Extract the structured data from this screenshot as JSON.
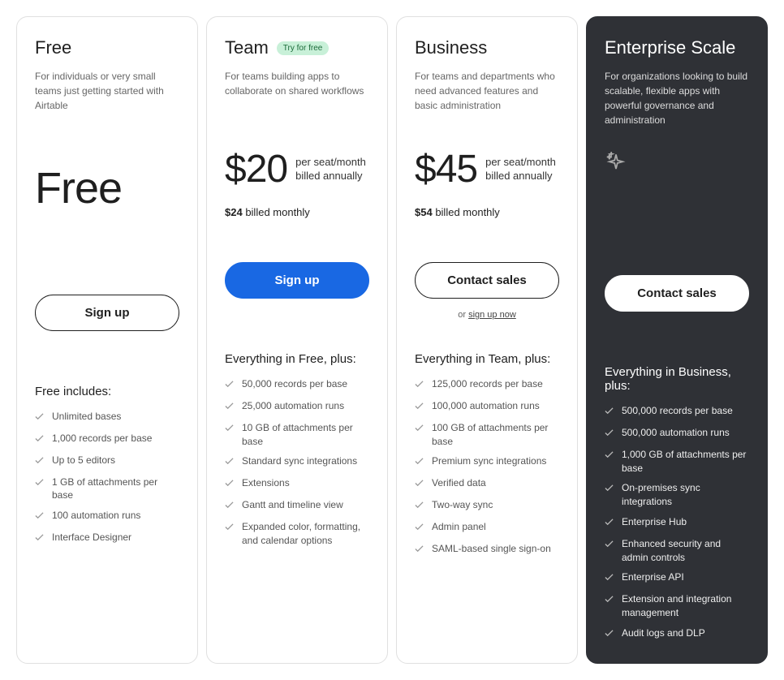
{
  "plans": [
    {
      "name": "Free",
      "badge": null,
      "desc": "For individuals or very small teams just getting started with Airtable",
      "price_big": "Free",
      "price_amount": null,
      "price_unit": null,
      "price_monthly_bold": null,
      "price_monthly_rest": null,
      "cta_label": "Sign up",
      "cta_style": "outline",
      "sub_cta_prefix": null,
      "sub_cta_link": null,
      "features_title": "Free includes:",
      "features": [
        "Unlimited bases",
        "1,000 records per base",
        "Up to 5 editors",
        "1 GB of attachments per base",
        "100 automation runs",
        "Interface Designer"
      ]
    },
    {
      "name": "Team",
      "badge": "Try for free",
      "desc": "For teams building apps to collaborate on shared workflows",
      "price_big": null,
      "price_amount": "$20",
      "price_unit": "per seat/month billed annually",
      "price_monthly_bold": "$24",
      "price_monthly_rest": " billed monthly",
      "cta_label": "Sign up",
      "cta_style": "primary",
      "sub_cta_prefix": null,
      "sub_cta_link": null,
      "features_title": "Everything in Free, plus:",
      "features": [
        "50,000 records per base",
        "25,000 automation runs",
        "10 GB of attachments per base",
        "Standard sync integrations",
        "Extensions",
        "Gantt and timeline view",
        "Expanded color, formatting, and calendar options"
      ]
    },
    {
      "name": "Business",
      "badge": null,
      "desc": "For teams and departments who need advanced features and basic administration",
      "price_big": null,
      "price_amount": "$45",
      "price_unit": "per seat/month billed annually",
      "price_monthly_bold": "$54",
      "price_monthly_rest": " billed monthly",
      "cta_label": "Contact sales",
      "cta_style": "outline",
      "sub_cta_prefix": "or ",
      "sub_cta_link": "sign up now",
      "features_title": "Everything in Team, plus:",
      "features": [
        "125,000 records per base",
        "100,000 automation runs",
        "100 GB of attachments per base",
        "Premium sync integrations",
        "Verified data",
        "Two-way sync",
        "Admin panel",
        "SAML-based single sign-on"
      ]
    },
    {
      "name": "Enterprise Scale",
      "badge": null,
      "desc": "For organizations looking to build scalable, flexible apps with powerful governance and administration",
      "price_big": null,
      "price_amount": null,
      "price_unit": null,
      "price_monthly_bold": null,
      "price_monthly_rest": null,
      "sparkle": true,
      "cta_label": "Contact sales",
      "cta_style": "outline",
      "sub_cta_prefix": null,
      "sub_cta_link": null,
      "features_title": "Everything in Business, plus:",
      "features": [
        "500,000 records per base",
        "500,000 automation runs",
        "1,000 GB of attachments per base",
        "On-premises sync integrations",
        "Enterprise Hub",
        "Enhanced security and admin controls",
        "Enterprise API",
        "Extension and integration management",
        "Audit logs and DLP"
      ]
    }
  ]
}
